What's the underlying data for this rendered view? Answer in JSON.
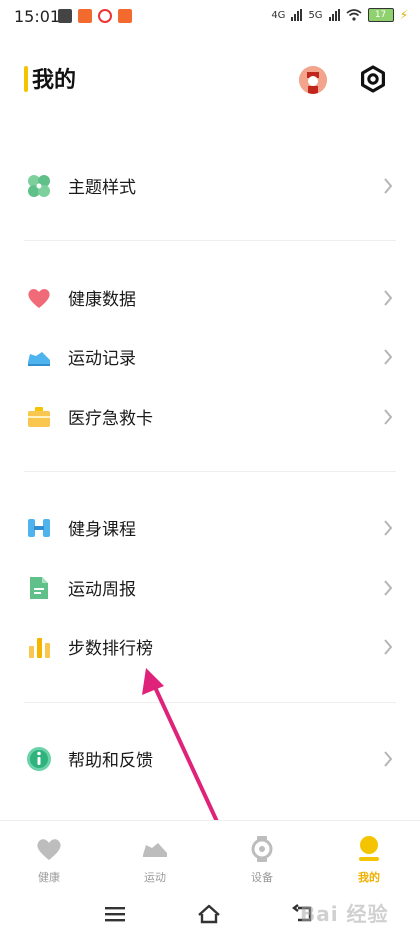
{
  "status": {
    "time": "15:01",
    "net1": "4G",
    "net2": "5G",
    "battery": "17"
  },
  "header": {
    "title": "我的"
  },
  "menu": {
    "theme": "主题样式",
    "health_data": "健康数据",
    "sport_record": "运动记录",
    "medical_card": "医疗急救卡",
    "fitness_course": "健身课程",
    "weekly_report": "运动周报",
    "step_rank": "步数排行榜",
    "help": "帮助和反馈"
  },
  "tabs": {
    "health": "健康",
    "sport": "运动",
    "device": "设备",
    "mine": "我的"
  },
  "watermark": "Bai 经验",
  "colors": {
    "accent": "#f5c400",
    "arrow": "#e0237a"
  }
}
